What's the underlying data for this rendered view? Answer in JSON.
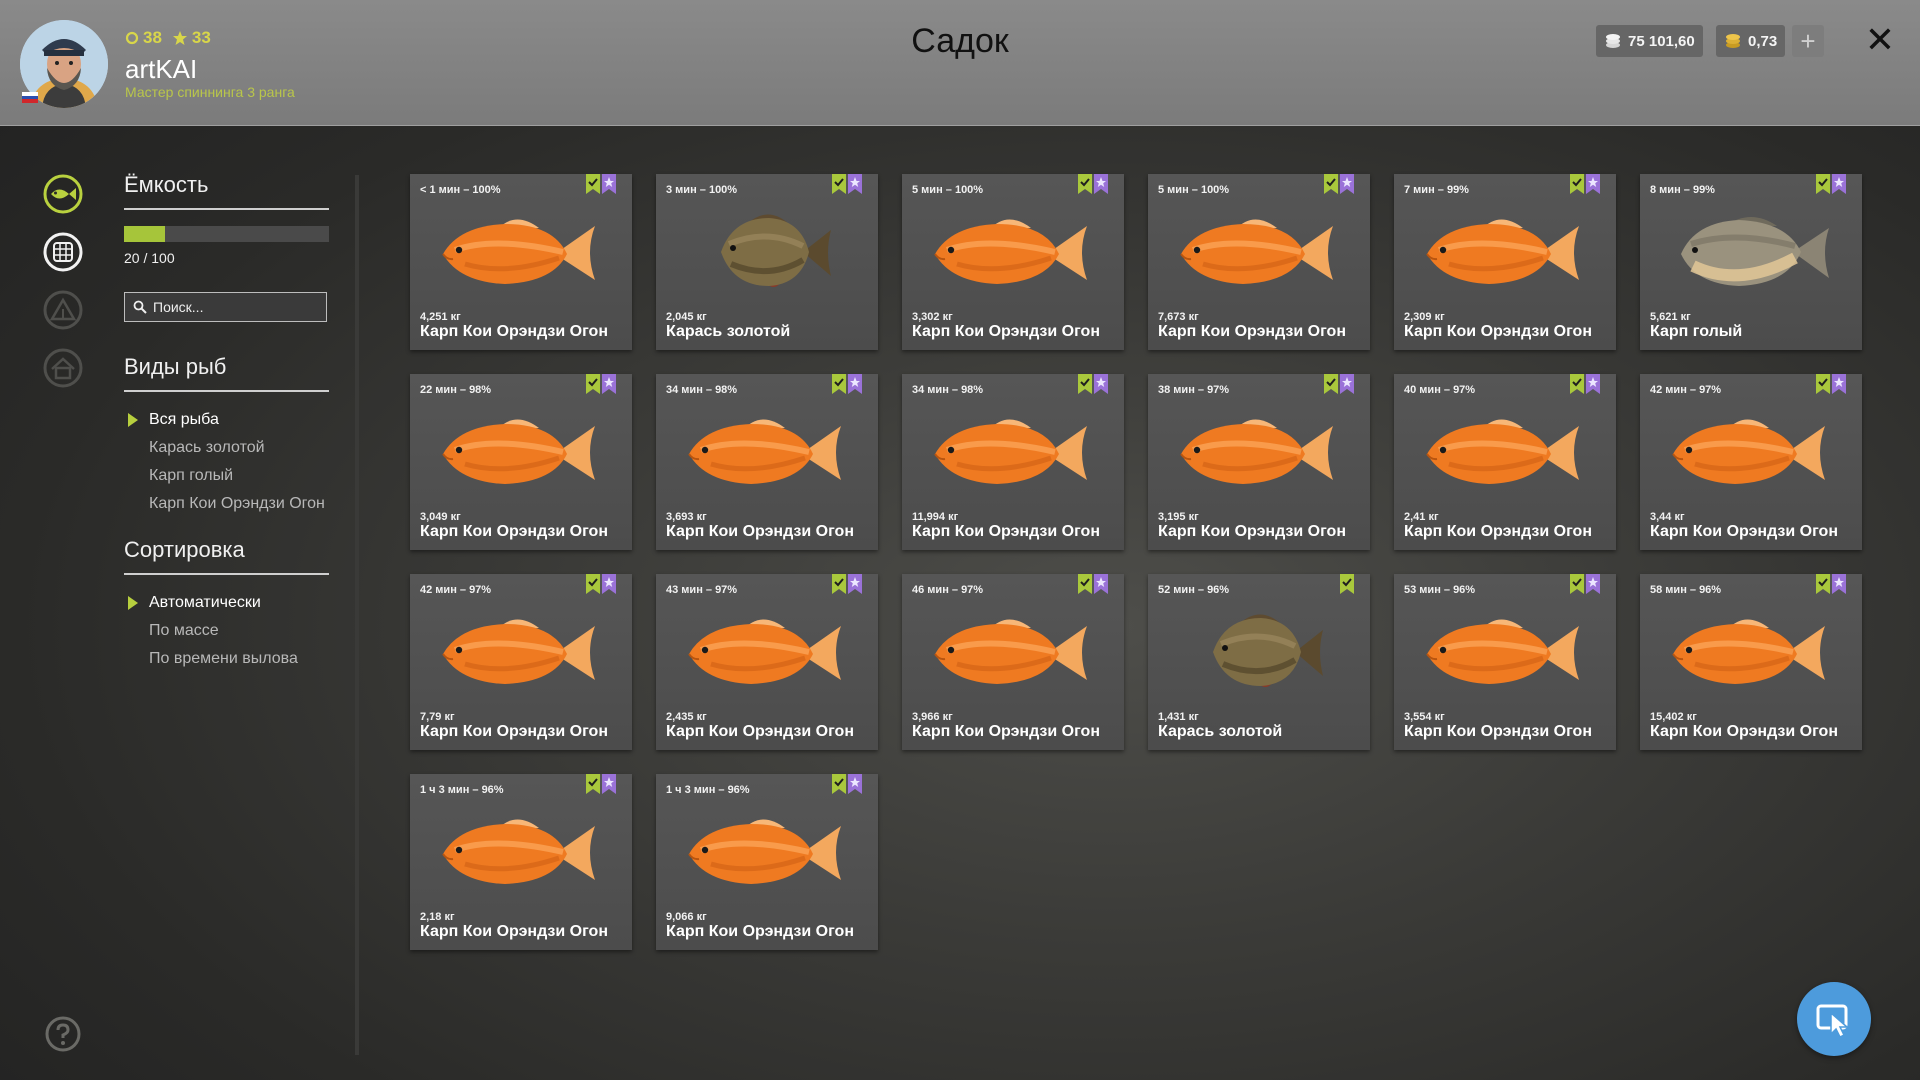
{
  "header": {
    "title": "Садок",
    "username": "artKAI",
    "rank": "Мастер спиннинга 3 ранга",
    "level": "38",
    "stars": "33",
    "silver": "75 101,60",
    "gold": "0,73",
    "plus_label": "+",
    "close_label": "✕"
  },
  "sidebar": {
    "capacity_title": "Ёмкость",
    "capacity_text": "20 / 100",
    "capacity_fraction": 0.2,
    "search_placeholder": "Поиск...",
    "species_title": "Виды рыб",
    "species": [
      "Вся рыба",
      "Карась золотой",
      "Карп голый",
      "Карп Кои Орэндзи Огон"
    ],
    "species_selected": 0,
    "sort_title": "Сортировка",
    "sort": [
      "Автоматически",
      "По массе",
      "По времени вылова"
    ],
    "sort_selected": 0
  },
  "colors": {
    "accent": "#a6c53a",
    "badge_green": "#a9c83c",
    "badge_purple": "#9a72d8",
    "cursor_button": "#4d9bdc"
  },
  "fish": [
    {
      "time": "< 1 мин – 100%",
      "weight": "4,251 кг",
      "name": "Карп Кои Орэндзи Огон",
      "kind": "koi",
      "badges": 2
    },
    {
      "time": "3 мин – 100%",
      "weight": "2,045 кг",
      "name": "Карась золотой",
      "kind": "crucian",
      "badges": 2
    },
    {
      "time": "5 мин – 100%",
      "weight": "3,302 кг",
      "name": "Карп Кои Орэндзи Огон",
      "kind": "koi",
      "badges": 2
    },
    {
      "time": "5 мин – 100%",
      "weight": "7,673 кг",
      "name": "Карп Кои Орэндзи Огон",
      "kind": "koi",
      "badges": 2
    },
    {
      "time": "7 мин – 99%",
      "weight": "2,309 кг",
      "name": "Карп Кои Орэндзи Огон",
      "kind": "koi",
      "badges": 2
    },
    {
      "time": "8 мин – 99%",
      "weight": "5,621 кг",
      "name": "Карп голый",
      "kind": "leather",
      "badges": 2
    },
    {
      "time": "22 мин – 98%",
      "weight": "3,049 кг",
      "name": "Карп Кои Орэндзи Огон",
      "kind": "koi",
      "badges": 2
    },
    {
      "time": "34 мин – 98%",
      "weight": "3,693 кг",
      "name": "Карп Кои Орэндзи Огон",
      "kind": "koi",
      "badges": 2
    },
    {
      "time": "34 мин – 98%",
      "weight": "11,994 кг",
      "name": "Карп Кои Орэндзи Огон",
      "kind": "koi",
      "badges": 2
    },
    {
      "time": "38 мин – 97%",
      "weight": "3,195 кг",
      "name": "Карп Кои Орэндзи Огон",
      "kind": "koi",
      "badges": 2
    },
    {
      "time": "40 мин – 97%",
      "weight": "2,41 кг",
      "name": "Карп Кои Орэндзи Огон",
      "kind": "koi",
      "badges": 2
    },
    {
      "time": "42 мин – 97%",
      "weight": "3,44 кг",
      "name": "Карп Кои Орэндзи Огон",
      "kind": "koi",
      "badges": 2
    },
    {
      "time": "42 мин – 97%",
      "weight": "7,79 кг",
      "name": "Карп Кои Орэндзи Огон",
      "kind": "koi",
      "badges": 2
    },
    {
      "time": "43 мин – 97%",
      "weight": "2,435 кг",
      "name": "Карп Кои Орэндзи Огон",
      "kind": "koi",
      "badges": 2
    },
    {
      "time": "46 мин – 97%",
      "weight": "3,966 кг",
      "name": "Карп Кои Орэндзи Огон",
      "kind": "koi",
      "badges": 2
    },
    {
      "time": "52 мин – 96%",
      "weight": "1,431 кг",
      "name": "Карась золотой",
      "kind": "crucian",
      "badges": 1
    },
    {
      "time": "53 мин – 96%",
      "weight": "3,554 кг",
      "name": "Карп Кои Орэндзи Огон",
      "kind": "koi",
      "badges": 2
    },
    {
      "time": "58 мин – 96%",
      "weight": "15,402 кг",
      "name": "Карп Кои Орэндзи Огон",
      "kind": "koi",
      "badges": 2
    },
    {
      "time": "1 ч 3 мин – 96%",
      "weight": "2,18 кг",
      "name": "Карп Кои Орэндзи Огон",
      "kind": "koi",
      "badges": 2
    },
    {
      "time": "1 ч 3 мин – 96%",
      "weight": "9,066 кг",
      "name": "Карп Кои Орэндзи Огон",
      "kind": "koi",
      "badges": 2
    }
  ],
  "icons": {
    "rail": [
      "fish-icon",
      "keepnet-icon",
      "tent-icon",
      "home-icon"
    ],
    "help": "help-icon",
    "cursor": "cursor-icon"
  }
}
